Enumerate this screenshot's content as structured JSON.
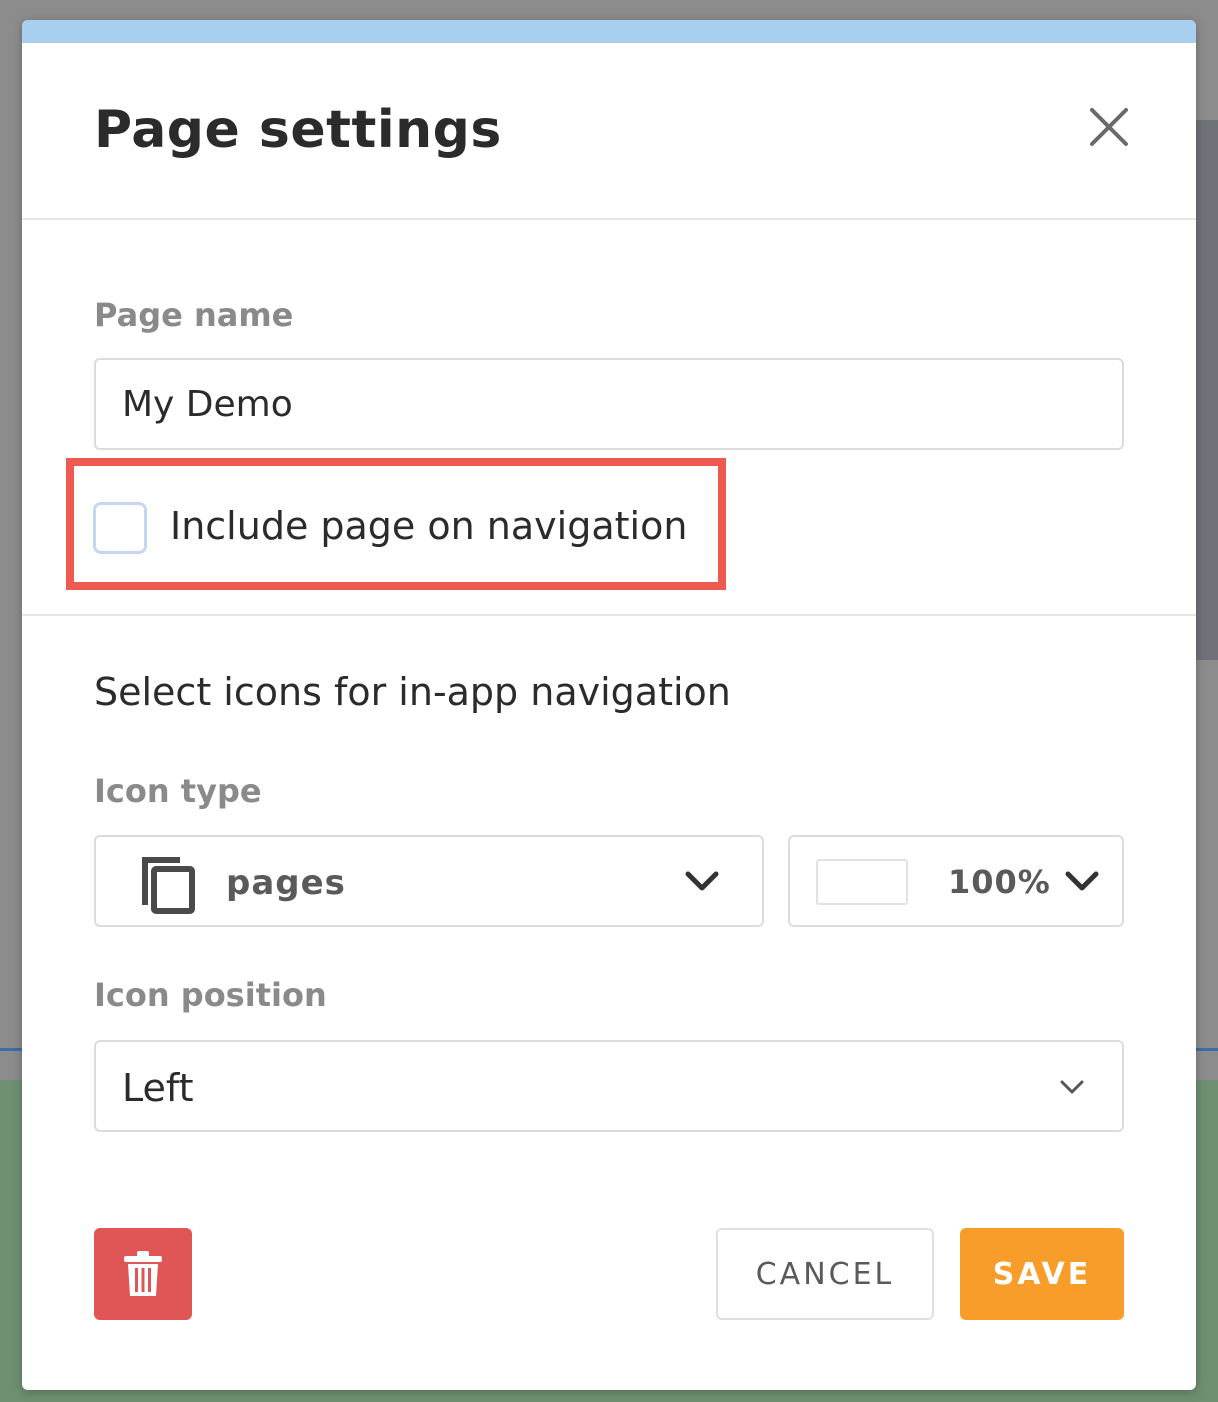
{
  "colors": {
    "accent_bar": "#a9cfee",
    "highlight": "#ee5a50",
    "delete_bg": "#e05555",
    "save_bg": "#f89c2a"
  },
  "dialog": {
    "title": "Page settings",
    "close_icon": "close-icon"
  },
  "page_name": {
    "label": "Page name",
    "value": "My Demo"
  },
  "include_navigation": {
    "label": "Include page on navigation",
    "checked": false
  },
  "icons_section": {
    "heading": "Select icons for in-app navigation",
    "icon_type": {
      "label": "Icon type",
      "icon": "pages-icon",
      "selected": "pages"
    },
    "icon_color": {
      "swatch": "#ffffff",
      "opacity": "100%"
    },
    "icon_position": {
      "label": "Icon position",
      "selected": "Left"
    }
  },
  "footer": {
    "delete_icon": "trash-icon",
    "cancel_label": "CANCEL",
    "save_label": "SAVE"
  }
}
